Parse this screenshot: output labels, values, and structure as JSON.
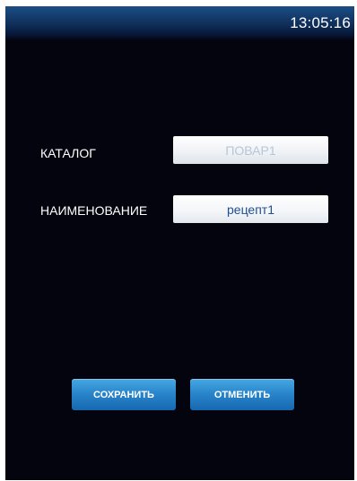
{
  "status_bar": {
    "time": "13:05:16"
  },
  "form": {
    "catalog": {
      "label": "КАТАЛОГ",
      "value": "ПОВАР1"
    },
    "name": {
      "label": "НАИМЕНОВАНИЕ",
      "value": "рецепт1"
    }
  },
  "actions": {
    "save_label": "СОХРАНИТЬ",
    "cancel_label": "ОТМЕНИТЬ"
  },
  "colors": {
    "background": "#04040f",
    "status_bar": "#1b4e86",
    "button": "#2a86cc",
    "field_text_active": "#1d4f92",
    "field_text_disabled": "#b7c6d6"
  }
}
